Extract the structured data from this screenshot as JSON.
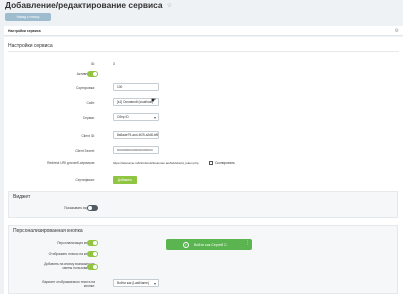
{
  "page": {
    "title": "Добавление/редактирование сервиса",
    "star_icon": "star-icon",
    "back_label": "Назад к списку"
  },
  "tabs": {
    "label": "Настройки сервиса",
    "gear_icon": "gear-icon"
  },
  "settings": {
    "header": "Настройки сервиса",
    "id_label": "ID:",
    "id_value": "3",
    "active_label": "Активность:",
    "active": true,
    "sort_label": "Сортировка:",
    "sort_value": "100",
    "site_label": "Сайт:",
    "site_value": "[s1] Основной (localhost)",
    "service_label": "Сервис:",
    "service_value": "Сбер ID",
    "client_id_label": "Client ID:",
    "client_id_value": "8a5aae79-acd-4f29-a2d8-bf5f0c064a08",
    "client_secret_label": "Client Secret:",
    "client_secret_value": "••••••••••••••••••••••••••••••••",
    "redirect_label": "Redirect URI для веб-сервисов:",
    "redirect_value": "https://sitename.ru/bitrix/tools/fusiontec.authsb/sberid_token.php",
    "copy_label": "Скопировать",
    "cert_label": "Сертификат:",
    "add_label": "Добавить"
  },
  "widget": {
    "header": "Виджет",
    "show_label": "Показывать виджет:",
    "show": false
  },
  "button": {
    "header": "Персонализированная кнопка",
    "personal_label": "Персонализация кнопки:",
    "personal": true,
    "hint_label": "Отображать плюсы на кнопке:",
    "hint": true,
    "add_fast_label": "Добавить на кнопку возможность смены пользователя:",
    "add_fast": true,
    "variant_label": "Вариант отображаемого текста на кнопке:",
    "variant_value": "Войти как {LastName}",
    "preview_label": "Войти как Сергей С.",
    "colors": {
      "accent": "#8fc540",
      "preview": "#5ab550"
    }
  }
}
